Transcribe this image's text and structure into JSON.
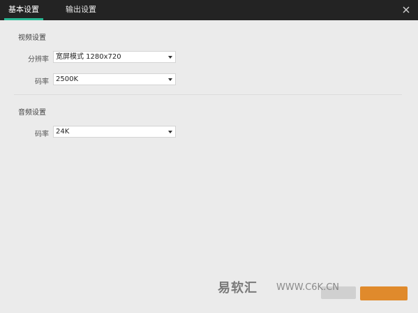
{
  "tabs": [
    {
      "label": "基本设置",
      "active": true
    },
    {
      "label": "输出设置",
      "active": false
    }
  ],
  "video": {
    "section_title": "视频设置",
    "resolution_label": "分辨率",
    "resolution_value": "宽屏模式 1280x720",
    "bitrate_label": "码率",
    "bitrate_value": "2500K"
  },
  "audio": {
    "section_title": "音频设置",
    "bitrate_label": "码率",
    "bitrate_value": "24K"
  },
  "watermark": {
    "brand": "易软汇",
    "site": "WWW.C6K.CN"
  },
  "colors": {
    "accent": "#2ab894",
    "titlebar": "#232323",
    "confirm_button": "#e08a2c"
  }
}
